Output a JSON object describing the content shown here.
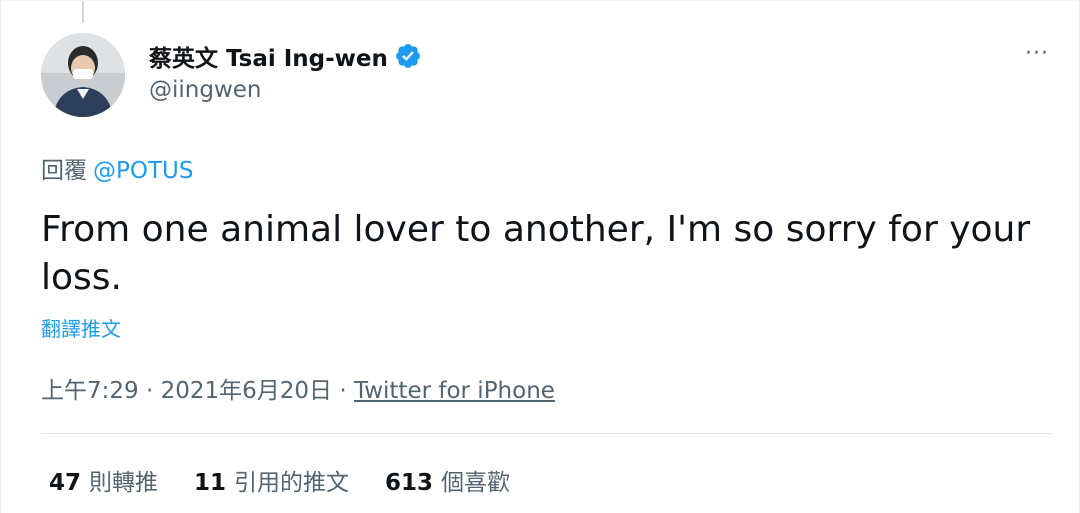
{
  "author": {
    "display_name": "蔡英文 Tsai Ing-wen",
    "handle": "@iingwen",
    "verified": true
  },
  "menu": {
    "more_icon": "more-horizontal-icon",
    "more_label": "···"
  },
  "reply": {
    "prefix": "回覆",
    "mention": "@POTUS"
  },
  "tweet": {
    "text": "From one animal lover to another, I'm so sorry for your loss.",
    "translate_label": "翻譯推文"
  },
  "meta": {
    "time": "上午7:29",
    "separator": " · ",
    "date": "2021年6月20日",
    "source": "Twitter for iPhone"
  },
  "stats": {
    "retweets": {
      "count": "47",
      "label": "則轉推"
    },
    "quotes": {
      "count": "11",
      "label": "引用的推文"
    },
    "likes": {
      "count": "613",
      "label": "個喜歡"
    }
  },
  "colors": {
    "link": "#1d9bf0",
    "secondary_text": "#536471",
    "primary_text": "#0f1419"
  }
}
